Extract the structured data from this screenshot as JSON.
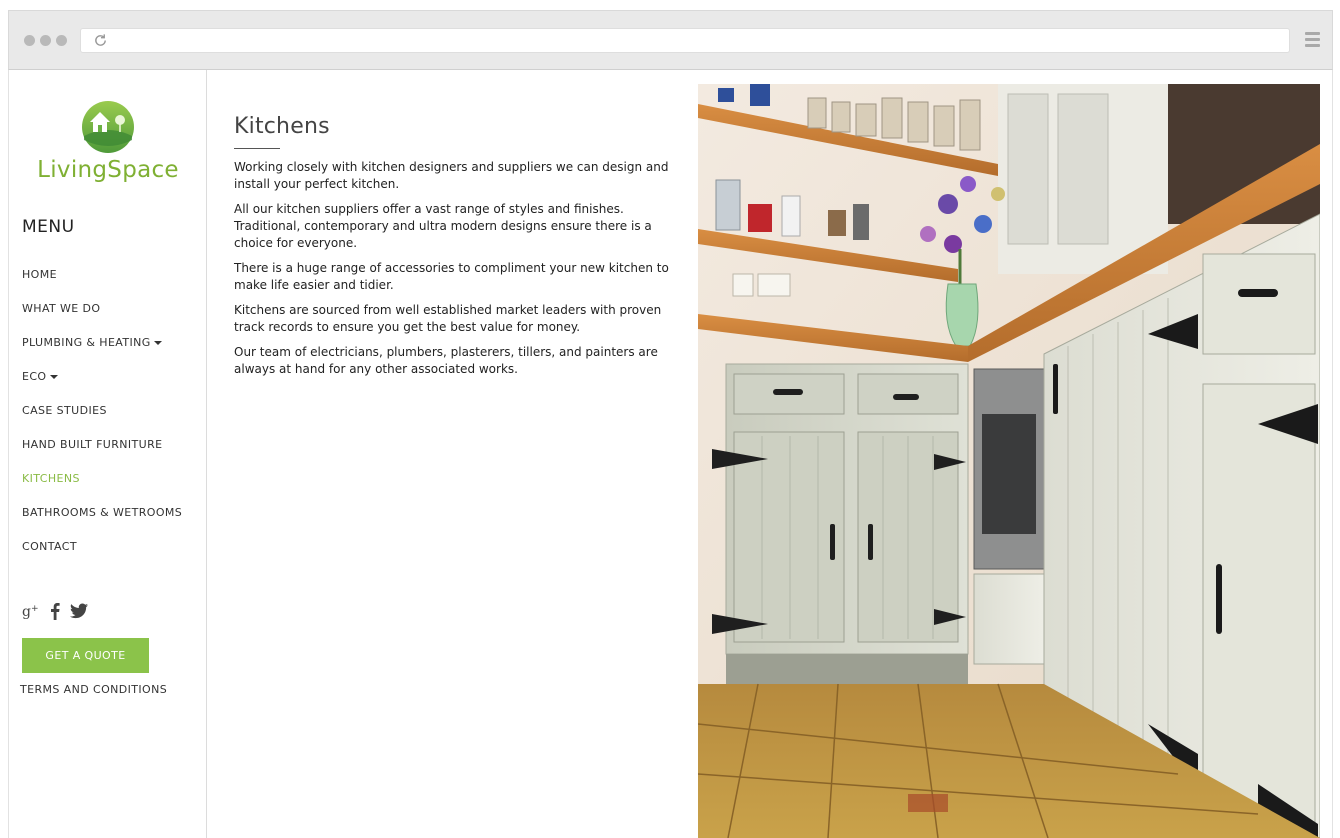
{
  "brand": {
    "name": "LivingSpace",
    "color_green": "#7fb033",
    "accent": "#8bc34a"
  },
  "sidebar": {
    "menu_title": "MENU",
    "items": [
      {
        "label": "HOME",
        "dropdown": false,
        "active": false
      },
      {
        "label": "WHAT WE DO",
        "dropdown": false,
        "active": false
      },
      {
        "label": "PLUMBING & HEATING",
        "dropdown": true,
        "active": false
      },
      {
        "label": "ECO",
        "dropdown": true,
        "active": false
      },
      {
        "label": "CASE STUDIES",
        "dropdown": false,
        "active": false
      },
      {
        "label": "HAND BUILT FURNITURE",
        "dropdown": false,
        "active": false
      },
      {
        "label": "KITCHENS",
        "dropdown": false,
        "active": true
      },
      {
        "label": "BATHROOMS & WETROOMS",
        "dropdown": false,
        "active": false
      },
      {
        "label": "CONTACT",
        "dropdown": false,
        "active": false
      }
    ],
    "social": [
      "google-plus-icon",
      "facebook-icon",
      "twitter-icon"
    ],
    "quote_button": "GET A QUOTE",
    "terms": "TERMS AND CONDITIONS"
  },
  "main": {
    "title": "Kitchens",
    "paragraphs": [
      "Working closely with kitchen designers and suppliers we can design and install your perfect kitchen.",
      "All our kitchen suppliers offer a vast range of styles and finishes. Traditional, contemporary and ultra modern designs ensure there is a choice for everyone.",
      "There is a huge range of accessories to compliment your new kitchen to make life easier and tidier.",
      "Kitchens are sourced from well established market leaders with proven track records to ensure you get the best value for money.",
      "Our team of electricians, plumbers, plasterers, tillers, and painters are always at hand for any other associated works."
    ],
    "image": "kitchen-photo"
  }
}
